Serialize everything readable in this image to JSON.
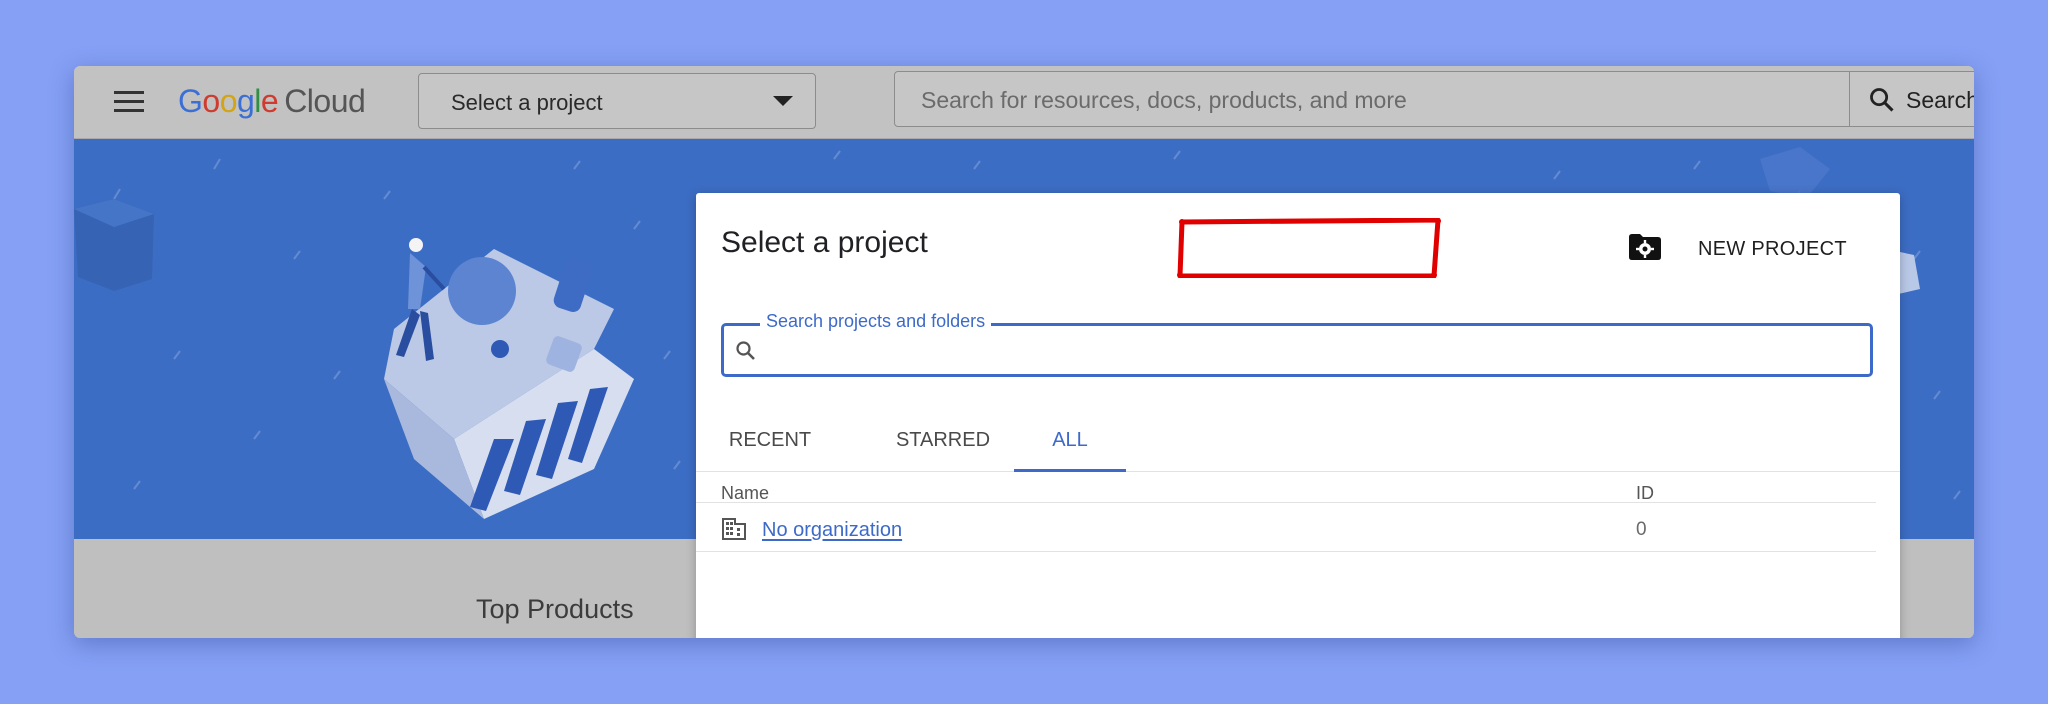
{
  "header": {
    "logo_google": [
      "G",
      "o",
      "o",
      "g",
      "l",
      "e"
    ],
    "logo_cloud": "Cloud",
    "project_selector_label": "Select a project",
    "search_placeholder": "Search for resources, docs, products, and more",
    "search_button_label": "Search"
  },
  "page": {
    "top_products_label": "Top Products"
  },
  "dialog": {
    "title": "Select a project",
    "new_project_label": "NEW PROJECT",
    "search_legend": "Search projects and folders",
    "search_value": "",
    "tabs": [
      {
        "label": "RECENT",
        "active": false
      },
      {
        "label": "STARRED",
        "active": false
      },
      {
        "label": "ALL",
        "active": true
      }
    ],
    "columns": {
      "name": "Name",
      "id": "ID"
    },
    "rows": [
      {
        "name": "No organization",
        "id": "0",
        "icon": "building-icon"
      }
    ]
  },
  "colors": {
    "page_background": "#85a0f5",
    "hero_blue": "#3c6dc4",
    "accent_blue": "#3d6ac9",
    "highlight_red": "#e00000"
  },
  "icons": [
    "menu-icon",
    "caret-down-icon",
    "search-icon",
    "folder-settings-icon",
    "building-icon"
  ]
}
